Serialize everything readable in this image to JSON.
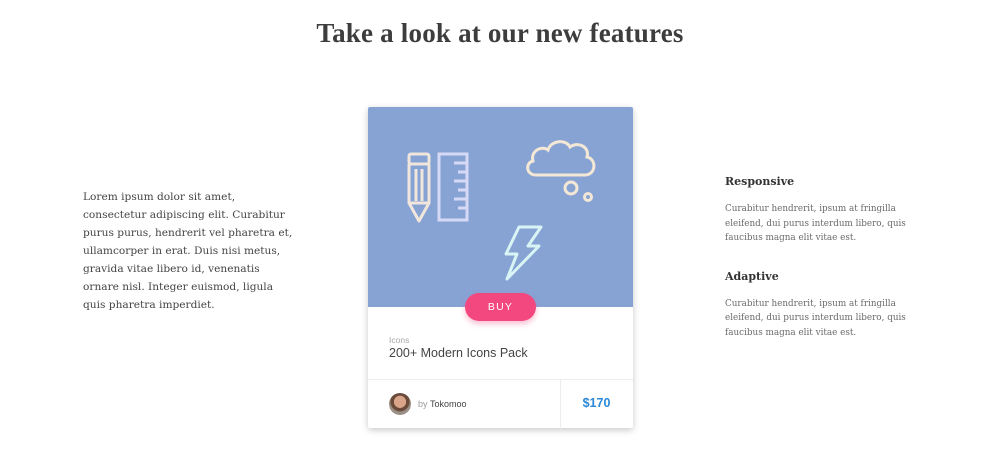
{
  "header": {
    "title": "Take a look at our new features"
  },
  "intro": {
    "text": "Lorem ipsum dolor sit amet, consectetur adipiscing elit. Curabitur purus purus, hendrerit vel pharetra et, ullamcorper in erat. Duis nisi metus, gravida vitae libero id, venenatis ornare nisl. Integer euismod, ligula quis pharetra imperdiet."
  },
  "features": [
    {
      "heading": "Responsive",
      "text": "Curabitur hendrerit, ipsum at fringilla eleifend, dui purus interdum libero, quis faucibus magna elit vitae est."
    },
    {
      "heading": "Adaptive",
      "text": "Curabitur hendrerit, ipsum at fringilla eleifend, dui purus interdum libero, quis faucibus magna elit vitae est."
    }
  ],
  "card": {
    "image_bg": "#87a3d4",
    "icons": [
      "pencil-icon",
      "ruler-icon",
      "thought-cloud-icon",
      "lightning-icon"
    ],
    "buy_label": "BUY",
    "category": "Icons",
    "name": "200+ Modern Icons Pack",
    "author_prefix": "by",
    "author": "Tokomoo",
    "price": "$170"
  },
  "colors": {
    "accent": "#f2487f",
    "price": "#2b88d8"
  }
}
